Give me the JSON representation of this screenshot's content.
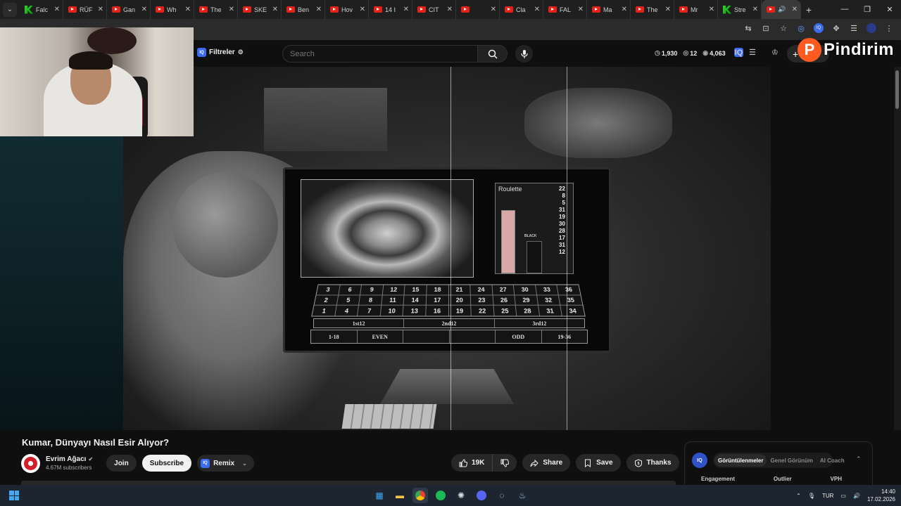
{
  "browser": {
    "tabs": [
      {
        "title": "Falc",
        "icon": "kick-icon"
      },
      {
        "title": "RÜF",
        "icon": "youtube-icon"
      },
      {
        "title": "Gan",
        "icon": "youtube-icon"
      },
      {
        "title": "Wh",
        "icon": "youtube-icon"
      },
      {
        "title": "The",
        "icon": "youtube-icon"
      },
      {
        "title": "SKE",
        "icon": "youtube-icon"
      },
      {
        "title": "Ben",
        "icon": "youtube-icon"
      },
      {
        "title": "Hov",
        "icon": "youtube-icon"
      },
      {
        "title": "14 I",
        "icon": "youtube-icon"
      },
      {
        "title": "CIT",
        "icon": "youtube-icon"
      },
      {
        "title": "",
        "icon": "youtube-icon"
      },
      {
        "title": "Cla",
        "icon": "youtube-icon"
      },
      {
        "title": "FAL",
        "icon": "youtube-icon"
      },
      {
        "title": "Ma",
        "icon": "youtube-icon"
      },
      {
        "title": "The",
        "icon": "youtube-icon"
      },
      {
        "title": "Mr",
        "icon": "youtube-icon"
      },
      {
        "title": "Stre",
        "icon": "kick-icon"
      }
    ],
    "active_tab_icon": "speaker-icon",
    "new_tab_label": "+",
    "close_glyph": "✕"
  },
  "header": {
    "filters_label": "Filtreler",
    "iq_label": "IQ",
    "search_placeholder": "Search",
    "stats": [
      {
        "icon": "clock-icon",
        "value": "1,930"
      },
      {
        "icon": "eye-icon",
        "value": "12"
      },
      {
        "icon": "eye-icon",
        "value": "4,063"
      }
    ],
    "create_label": "+"
  },
  "watermark": {
    "logo_letter": "P",
    "text": "Pindirim"
  },
  "video": {
    "roulette_title": "Roulette",
    "roulette_black": "BLACK",
    "history_numbers": [
      "22",
      "8",
      "5",
      "31",
      "19",
      "30",
      "28",
      "17",
      "31",
      "12"
    ],
    "table_numbers": [
      "3",
      "6",
      "9",
      "12",
      "15",
      "18",
      "21",
      "24",
      "27",
      "30",
      "33",
      "36",
      "2",
      "5",
      "8",
      "11",
      "14",
      "17",
      "20",
      "23",
      "26",
      "29",
      "32",
      "35",
      "1",
      "4",
      "7",
      "10",
      "13",
      "16",
      "19",
      "22",
      "25",
      "28",
      "31",
      "34"
    ],
    "dozens": [
      "1st12",
      "2nd12",
      "3rd12"
    ],
    "outside_bets": [
      "1-18",
      "EVEN",
      "",
      "",
      "ODD",
      "19-36"
    ]
  },
  "below": {
    "title": "Kumar, Dünyayı Nasıl Esir Alıyor?",
    "channel_name": "Evrim Ağacı",
    "subscribers": "4.67M subscribers",
    "join_label": "Join",
    "subscribe_label": "Subscribe",
    "remix_label": "Remix",
    "like_count": "19K",
    "share_label": "Share",
    "save_label": "Save",
    "thanks_label": "Thanks",
    "more_label": "•••"
  },
  "iq_panel": {
    "logo": "IQ",
    "tabs": [
      "Görüntülenmeler",
      "Genel Görünüm",
      "AI Coach"
    ],
    "columns": [
      "Engagement",
      "Outlier",
      "VPH"
    ]
  },
  "taskbar": {
    "language": "TUR",
    "time": "14:40",
    "date": "17.02.2026"
  },
  "colors": {
    "accent_blue": "#3b6cf0",
    "youtube_red": "#e62117",
    "pindirim_orange": "#ff5a1f"
  }
}
